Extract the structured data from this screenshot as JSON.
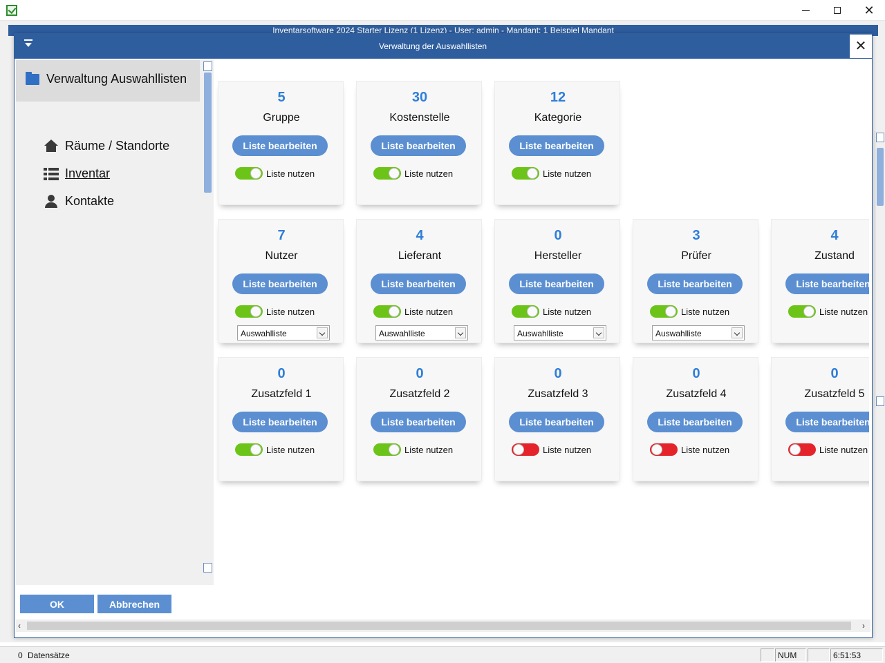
{
  "window": {
    "title": "Inventarsoftware 2024 Starter Lizenz (1 Lizenz) - User: admin - Mandant: 1 Beispiel Mandant",
    "minimize": "",
    "maximize": "",
    "close": "✕"
  },
  "dialog": {
    "title": "Verwaltung der Auswahllisten",
    "close": "✕"
  },
  "sidebar": {
    "header": "Verwaltung Auswahllisten",
    "items": [
      {
        "label": "Räume / Standorte",
        "icon": "home-icon"
      },
      {
        "label": "Inventar",
        "icon": "list-icon"
      },
      {
        "label": "Kontakte",
        "icon": "user-icon"
      }
    ]
  },
  "common": {
    "edit_label": "Liste bearbeiten",
    "use_label": "Liste nutzen",
    "select_value": "Auswahlliste"
  },
  "cards": [
    {
      "count": "5",
      "name": "Gruppe",
      "enabled": true,
      "select": false
    },
    {
      "count": "30",
      "name": "Kostenstelle",
      "enabled": true,
      "select": false
    },
    {
      "count": "12",
      "name": "Kategorie",
      "enabled": true,
      "select": false
    },
    {
      "count": "7",
      "name": "Nutzer",
      "enabled": true,
      "select": true
    },
    {
      "count": "4",
      "name": "Lieferant",
      "enabled": true,
      "select": true
    },
    {
      "count": "0",
      "name": "Hersteller",
      "enabled": true,
      "select": true
    },
    {
      "count": "3",
      "name": "Prüfer",
      "enabled": true,
      "select": true
    },
    {
      "count": "4",
      "name": "Zustand",
      "enabled": true,
      "select": false
    },
    {
      "count": "0",
      "name": "Zusatzfeld 1",
      "enabled": true,
      "select": false
    },
    {
      "count": "0",
      "name": "Zusatzfeld 2",
      "enabled": true,
      "select": false
    },
    {
      "count": "0",
      "name": "Zusatzfeld 3",
      "enabled": false,
      "select": false
    },
    {
      "count": "0",
      "name": "Zusatzfeld 4",
      "enabled": false,
      "select": false
    },
    {
      "count": "0",
      "name": "Zusatzfeld 5",
      "enabled": false,
      "select": false
    }
  ],
  "buttons": {
    "ok": "OK",
    "cancel": "Abbrechen"
  },
  "statusbar": {
    "count": "0",
    "label": "Datensätze",
    "num": "NUM",
    "time": "6:51:53"
  },
  "colors": {
    "header": "#2f5e9e",
    "accent": "#2f7ed8",
    "button": "#5b8fd1",
    "toggle_on": "#6cc419",
    "toggle_off": "#e4242a"
  }
}
